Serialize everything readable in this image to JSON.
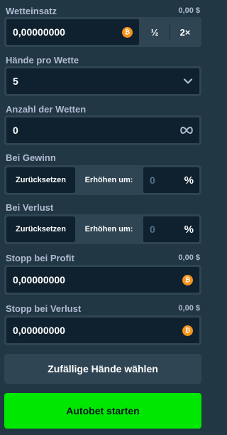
{
  "bet_amount": {
    "label": "Wetteinsatz",
    "fiat": "0,00 $",
    "value": "0,00000000",
    "half_label": "½",
    "double_label": "2×",
    "currency_icon": "bitcoin-icon"
  },
  "hands_per_bet": {
    "label": "Hände pro Wette",
    "value": "5"
  },
  "number_of_bets": {
    "label": "Anzahl der Wetten",
    "value": "0"
  },
  "on_win": {
    "label": "Bei Gewinn",
    "reset_label": "Zurücksetzen",
    "increase_label": "Erhöhen um:",
    "value": "0",
    "unit": "%"
  },
  "on_loss": {
    "label": "Bei Verlust",
    "reset_label": "Zurücksetzen",
    "increase_label": "Erhöhen um:",
    "value": "0",
    "unit": "%"
  },
  "stop_profit": {
    "label": "Stopp bei Profit",
    "fiat": "0,00 $",
    "value": "0,00000000"
  },
  "stop_loss": {
    "label": "Stopp bei Verlust",
    "fiat": "0,00 $",
    "value": "0,00000000"
  },
  "random_button": "Zufällige Hände wählen",
  "autobet_button": "Autobet starten",
  "colors": {
    "background": "#213743",
    "input": "#0f212e",
    "border": "#2f4553",
    "accent_green": "#00e701",
    "bitcoin": "#f7931a"
  }
}
